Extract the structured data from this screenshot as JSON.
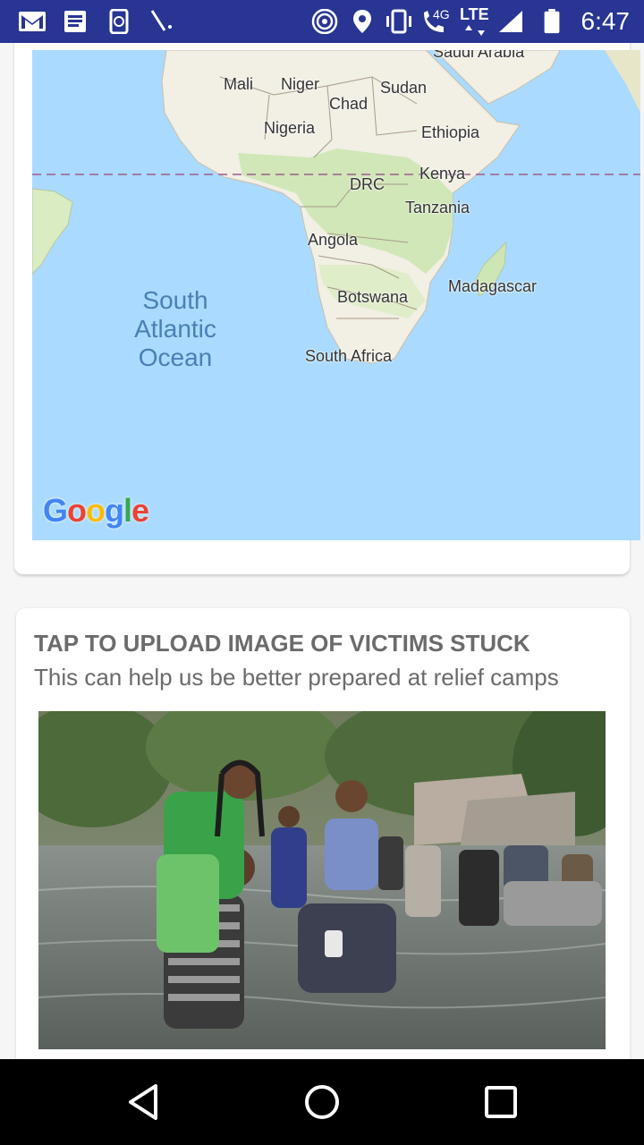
{
  "status_bar": {
    "time": "6:47",
    "network_label": "4G",
    "lte_label": "LTE",
    "icons": [
      "gmail-icon",
      "news-icon",
      "phone-sync-icon",
      "pen-icon",
      "hotspot-icon",
      "location-icon",
      "vibrate-icon",
      "wifi-calling-icon",
      "lte-icon",
      "signal-icon",
      "battery-icon"
    ]
  },
  "map": {
    "ocean_label": "South\nAtlantic\nOcean",
    "provider_logo": "Google",
    "countries": [
      {
        "name": "Saudi Arabia"
      },
      {
        "name": "Mali"
      },
      {
        "name": "Niger"
      },
      {
        "name": "Sudan"
      },
      {
        "name": "Chad"
      },
      {
        "name": "Nigeria"
      },
      {
        "name": "Ethiopia"
      },
      {
        "name": "Kenya"
      },
      {
        "name": "DRC"
      },
      {
        "name": "Tanzania"
      },
      {
        "name": "Angola"
      },
      {
        "name": "Madagascar"
      },
      {
        "name": "Botswana"
      },
      {
        "name": "South Africa"
      }
    ],
    "colors": {
      "water": "#aadaff",
      "land": "#f2efe4",
      "vegetation": "#cde6b3",
      "equator": "#9b5d8e"
    }
  },
  "upload_card": {
    "title": "TAP TO UPLOAD IMAGE OF VICTIMS STUCK",
    "subtitle": "This can help us be better prepared at relief camps"
  },
  "nav_bar": {
    "icons": [
      "back-icon",
      "home-icon",
      "recents-icon"
    ]
  }
}
